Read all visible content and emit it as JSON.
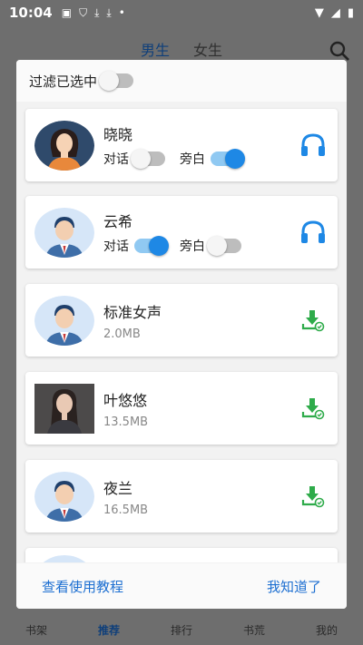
{
  "status": {
    "time": "10:04"
  },
  "background": {
    "tabs": [
      {
        "label": "男生"
      },
      {
        "label": "女生"
      }
    ],
    "nav": [
      {
        "label": "书架"
      },
      {
        "label": "推荐"
      },
      {
        "label": "排行"
      },
      {
        "label": "书荒"
      },
      {
        "label": "我的"
      }
    ]
  },
  "dialog": {
    "filter_label": "过滤已选中",
    "filter_on": false,
    "voices": [
      {
        "name": "晓晓",
        "dialog_label": "对话",
        "dialog_on": false,
        "narration_label": "旁白",
        "narration_on": true,
        "action": "headphones-icon",
        "avatar": "female"
      },
      {
        "name": "云希",
        "dialog_label": "对话",
        "dialog_on": true,
        "narration_label": "旁白",
        "narration_on": false,
        "action": "headphones-icon",
        "avatar": "male"
      },
      {
        "name": "标准女声",
        "size": "2.0MB",
        "action": "download-icon",
        "avatar": "male"
      },
      {
        "name": "叶悠悠",
        "size": "13.5MB",
        "action": "download-icon",
        "avatar": "photo"
      },
      {
        "name": "夜兰",
        "size": "16.5MB",
        "action": "download-icon",
        "avatar": "male"
      }
    ],
    "footer": {
      "tutorial": "查看使用教程",
      "ok": "我知道了"
    }
  },
  "colors": {
    "accent": "#1e88e5",
    "link": "#1d6fd1",
    "download": "#2eab4a"
  }
}
